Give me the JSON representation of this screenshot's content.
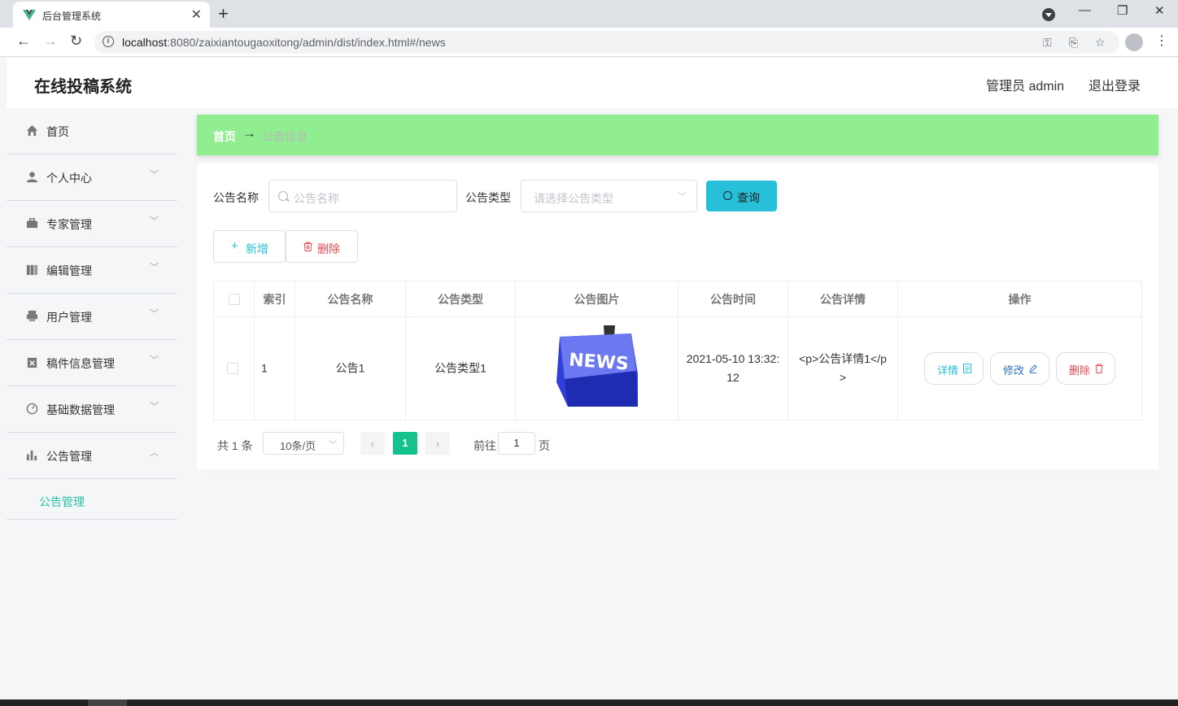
{
  "browser": {
    "tab_title": "后台管理系统",
    "url_host": "localhost",
    "url_rest": ":8080/zaixiantougaoxitong/admin/dist/index.html#/news",
    "close_glyph": "✕",
    "new_tab_glyph": "+"
  },
  "app": {
    "title": "在线投稿系统",
    "user": "管理员 admin",
    "logout": "退出登录"
  },
  "sidebar": {
    "items": [
      {
        "label": "首页",
        "icon": "home-icon"
      },
      {
        "label": "个人中心",
        "icon": "user-icon"
      },
      {
        "label": "专家管理",
        "icon": "briefcase-icon"
      },
      {
        "label": "编辑管理",
        "icon": "book-icon"
      },
      {
        "label": "用户管理",
        "icon": "printer-icon"
      },
      {
        "label": "稿件信息管理",
        "icon": "clipboard-icon"
      },
      {
        "label": "基础数据管理",
        "icon": "gauge-icon"
      },
      {
        "label": "公告管理",
        "icon": "bar-chart-icon"
      }
    ],
    "sub_item": "公告管理"
  },
  "breadcrumb": {
    "home": "首页",
    "separator": "→",
    "current": "公告信息"
  },
  "search": {
    "name_label": "公告名称",
    "name_placeholder": "公告名称",
    "type_label": "公告类型",
    "type_placeholder": "请选择公告类型",
    "query_label": "查询"
  },
  "actions": {
    "add": "新增",
    "delete": "删除"
  },
  "table": {
    "headers": [
      "索引",
      "公告名称",
      "公告类型",
      "公告图片",
      "公告时间",
      "公告详情",
      "操作"
    ],
    "rows": [
      {
        "index": "1",
        "name": "公告1",
        "type": "公告类型1",
        "image": "NEWS",
        "time": "2021-05-10 13:32:12",
        "detail": "<p>公告详情1</p>",
        "ops": {
          "detail": "详情",
          "edit": "修改",
          "delete": "删除"
        }
      }
    ]
  },
  "pagination": {
    "total": "共 1 条",
    "page_size": "10条/页",
    "current_page": "1",
    "goto_label": "前往",
    "goto_value": "1",
    "page_suffix": "页"
  },
  "colors": {
    "accent": "#26c1d8",
    "breadcrumb_bg": "#90ee90",
    "page_active": "#14c28e",
    "danger": "#e8474b",
    "sub_active": "#28c0a4"
  }
}
